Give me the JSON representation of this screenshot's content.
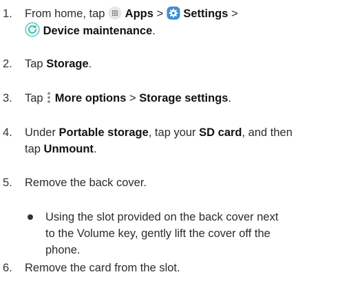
{
  "steps": [
    {
      "number": "1.",
      "line1": {
        "pre": "From home, tap",
        "apps_label": "Apps",
        "sep1": ">",
        "settings_label": "Settings",
        "sep2": ">"
      },
      "line2": {
        "device_maintenance_label": "Device maintenance",
        "end": "."
      }
    },
    {
      "number": "2.",
      "pre": "Tap",
      "storage_label": "Storage",
      "end": "."
    },
    {
      "number": "3.",
      "pre": "Tap",
      "more_options_label": "More options",
      "sep": ">",
      "storage_settings_label": "Storage settings",
      "end": "."
    },
    {
      "number": "4.",
      "line1": {
        "pre": "Under",
        "portable_storage_label": "Portable storage",
        "mid": ", tap your",
        "sd_card_label": "SD card",
        "post": ", and then"
      },
      "line2": {
        "pre": "tap",
        "unmount_label": "Unmount",
        "end": "."
      }
    },
    {
      "number": "5.",
      "text": "Remove the back cover."
    },
    {
      "bullet_lines": [
        "Using the slot provided on the back cover next",
        "to the Volume key, gently lift the cover off the",
        "phone."
      ]
    },
    {
      "number": "6.",
      "text": "Remove the card from the slot."
    }
  ],
  "icons": {
    "apps": "apps-grid-icon",
    "settings": "settings-gear-icon",
    "device_maintenance": "device-maintenance-icon",
    "more_options": "more-options-vertical-dots-icon"
  },
  "colors": {
    "settings_icon_bg": "#3d8fd8",
    "device_maintenance_icon": "#29b5a3",
    "apps_icon_bg": "#e6e6e6"
  }
}
